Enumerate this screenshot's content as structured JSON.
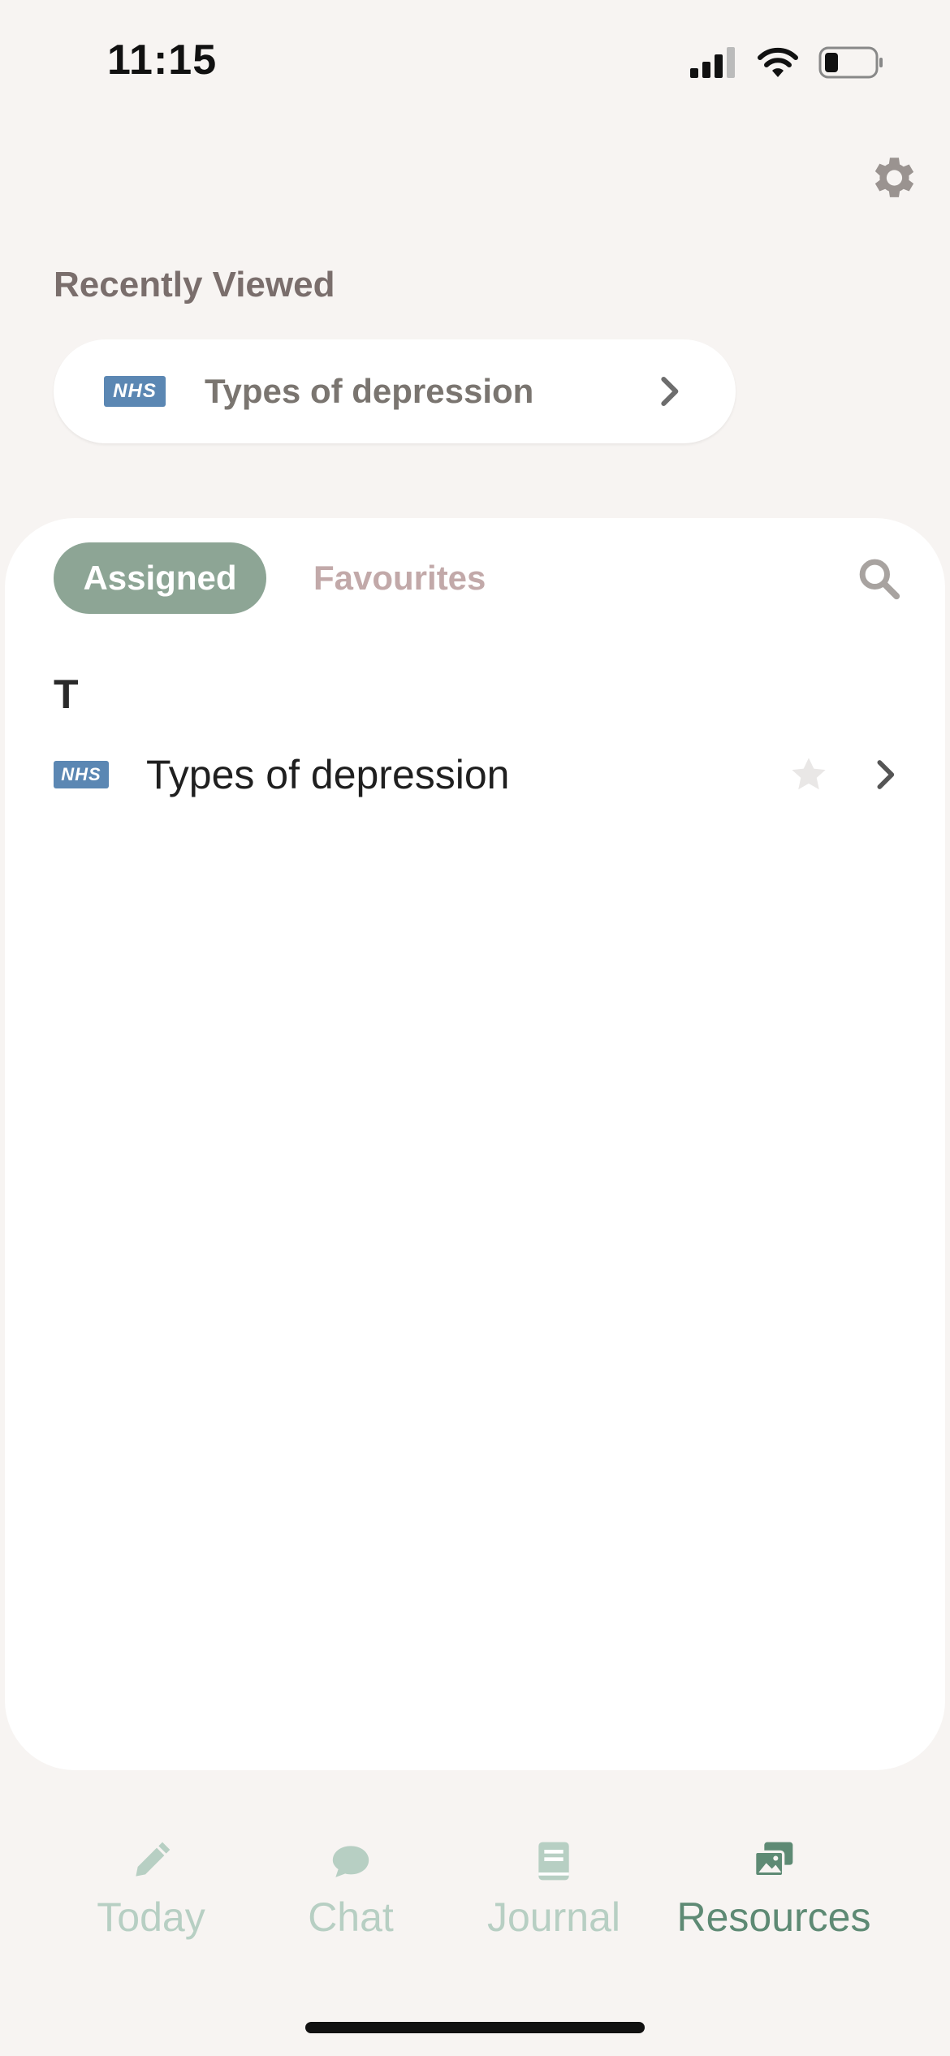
{
  "status": {
    "time": "11:15"
  },
  "recent": {
    "title": "Recently Viewed",
    "item": {
      "badge": "NHS",
      "label": "Types of depression"
    }
  },
  "tabs": {
    "assigned": "Assigned",
    "favourites": "Favourites"
  },
  "list": {
    "section": "T",
    "items": [
      {
        "badge": "NHS",
        "label": "Types of depression",
        "favourite": false
      }
    ]
  },
  "nav": {
    "items": [
      {
        "label": "Today",
        "icon": "pencil-icon",
        "active": false
      },
      {
        "label": "Chat",
        "icon": "chat-bubble-icon",
        "active": false
      },
      {
        "label": "Journal",
        "icon": "book-icon",
        "active": false
      },
      {
        "label": "Resources",
        "icon": "images-icon",
        "active": true
      }
    ]
  },
  "colors": {
    "accent": "#8da595",
    "nav_active": "#5e8a74",
    "nav_inactive": "#b7cfc3",
    "nhs_blue": "#5b87b3",
    "favourites_tab": "#c2a9a9"
  }
}
